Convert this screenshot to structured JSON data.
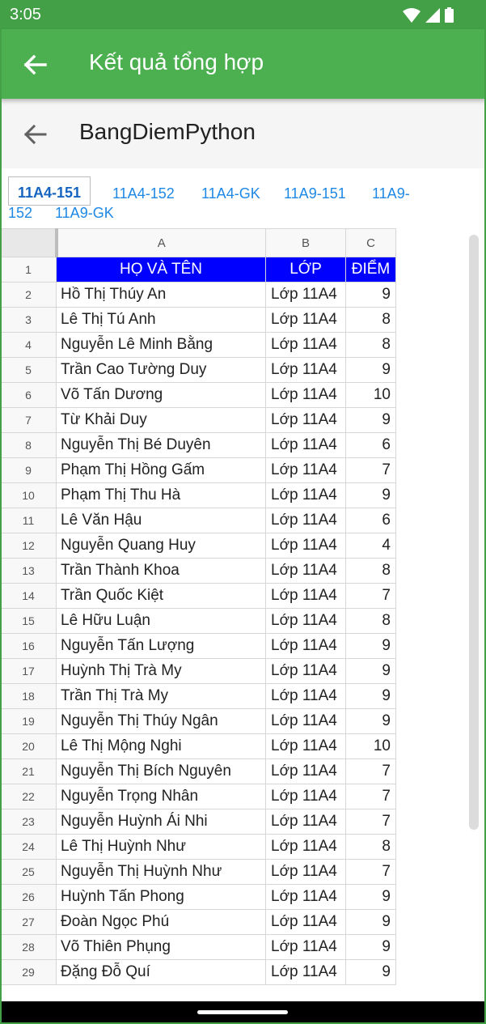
{
  "status_bar": {
    "time": "3:05"
  },
  "app_bar": {
    "title": "Kết quả tổng hợp"
  },
  "sheet_bar": {
    "title": "BangDiemPython"
  },
  "tabs": [
    "11A4-151",
    "11A4-152",
    "11A4-GK",
    "11A9-151",
    "11A9-152",
    "11A9-GK"
  ],
  "tab_wrap": {
    "part1": "11A9-",
    "part2": "152"
  },
  "columns": [
    "A",
    "B",
    "C"
  ],
  "header_row": {
    "num": "1",
    "name": "HỌ VÀ TÊN",
    "class": "LỚP",
    "score": "ĐIỂM"
  },
  "header_color": "#0000ff",
  "rows": [
    {
      "num": "2",
      "name": "Hồ Thị Thúy An",
      "class": "Lớp 11A4",
      "score": "9"
    },
    {
      "num": "3",
      "name": "Lê Thị Tú Anh",
      "class": "Lớp 11A4",
      "score": "8"
    },
    {
      "num": "4",
      "name": "Nguyễn Lê Minh Bằng",
      "class": "Lớp 11A4",
      "score": "8"
    },
    {
      "num": "5",
      "name": "Trần Cao Tường Duy",
      "class": "Lớp 11A4",
      "score": "9"
    },
    {
      "num": "6",
      "name": "Võ Tấn Dương",
      "class": "Lớp 11A4",
      "score": "10"
    },
    {
      "num": "7",
      "name": "Từ Khải Duy",
      "class": "Lớp 11A4",
      "score": "9"
    },
    {
      "num": "8",
      "name": "Nguyễn Thị Bé Duyên",
      "class": "Lớp 11A4",
      "score": "6"
    },
    {
      "num": "9",
      "name": "Phạm Thị Hồng Gấm",
      "class": "Lớp 11A4",
      "score": "7"
    },
    {
      "num": "10",
      "name": "Phạm Thị Thu Hà",
      "class": "Lớp 11A4",
      "score": "9"
    },
    {
      "num": "11",
      "name": "Lê Văn Hậu",
      "class": "Lớp 11A4",
      "score": "6"
    },
    {
      "num": "12",
      "name": "Nguyễn Quang Huy",
      "class": "Lớp 11A4",
      "score": "4"
    },
    {
      "num": "13",
      "name": "Trần Thành Khoa",
      "class": "Lớp 11A4",
      "score": "8"
    },
    {
      "num": "14",
      "name": "Trần Quốc Kiệt",
      "class": "Lớp 11A4",
      "score": "7"
    },
    {
      "num": "15",
      "name": "Lê Hữu Luận",
      "class": "Lớp 11A4",
      "score": "8"
    },
    {
      "num": "16",
      "name": "Nguyễn Tấn Lượng",
      "class": "Lớp 11A4",
      "score": "9"
    },
    {
      "num": "17",
      "name": "Huỳnh Thị Trà My",
      "class": "Lớp 11A4",
      "score": "9"
    },
    {
      "num": "18",
      "name": "Trần Thị Trà My",
      "class": "Lớp 11A4",
      "score": "9"
    },
    {
      "num": "19",
      "name": "Nguyễn Thị Thúy Ngân",
      "class": "Lớp 11A4",
      "score": "9"
    },
    {
      "num": "20",
      "name": "Lê Thị Mộng Nghi",
      "class": "Lớp 11A4",
      "score": "10"
    },
    {
      "num": "21",
      "name": "Nguyễn Thị Bích Nguyên",
      "class": "Lớp 11A4",
      "score": "7"
    },
    {
      "num": "22",
      "name": "Nguyễn Trọng Nhân",
      "class": "Lớp 11A4",
      "score": "7"
    },
    {
      "num": "23",
      "name": "Nguyễn Huỳnh Ái Nhi",
      "class": "Lớp 11A4",
      "score": "7"
    },
    {
      "num": "24",
      "name": "Lê Thị Huỳnh Như",
      "class": "Lớp 11A4",
      "score": "8"
    },
    {
      "num": "25",
      "name": "Nguyễn Thị Huỳnh Như",
      "class": "Lớp 11A4",
      "score": "7"
    },
    {
      "num": "26",
      "name": "Huỳnh Tấn Phong",
      "class": "Lớp 11A4",
      "score": "9"
    },
    {
      "num": "27",
      "name": "Đoàn Ngọc Phú",
      "class": "Lớp 11A4",
      "score": "9"
    },
    {
      "num": "28",
      "name": "Võ Thiên Phụng",
      "class": "Lớp 11A4",
      "score": "9"
    },
    {
      "num": "29",
      "name": "Đặng Đỗ Quí",
      "class": "Lớp 11A4",
      "score": "9"
    }
  ]
}
